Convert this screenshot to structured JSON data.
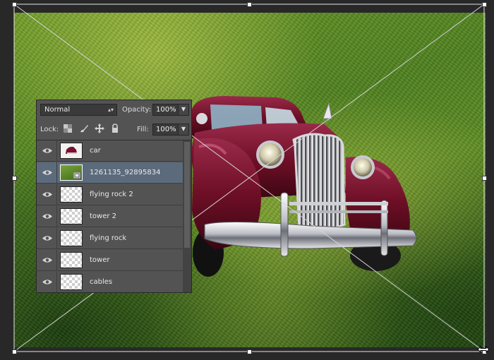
{
  "canvas": {
    "image_subject": "vintage maroon car on grass texture"
  },
  "layers_panel": {
    "blend_mode": "Normal",
    "opacity_label": "Opacity:",
    "opacity_value": "100%",
    "lock_label": "Lock:",
    "fill_label": "Fill:",
    "fill_value": "100%",
    "lock_icons": [
      "lock-transparent-pixels-icon",
      "lock-image-pixels-icon",
      "lock-position-icon",
      "lock-all-icon"
    ],
    "layers": [
      {
        "name": "car",
        "thumb": "car-thumb",
        "active": false
      },
      {
        "name": "1261135_92895834",
        "thumb": "grass-thumb",
        "active": true
      },
      {
        "name": "flying rock 2",
        "thumb": "transparent",
        "active": false
      },
      {
        "name": "tower 2",
        "thumb": "transparent",
        "active": false
      },
      {
        "name": "flying rock",
        "thumb": "transparent",
        "active": false
      },
      {
        "name": "tower",
        "thumb": "transparent",
        "active": false
      },
      {
        "name": "cables",
        "thumb": "transparent",
        "active": false
      }
    ]
  },
  "colors": {
    "panel_bg": "#535353",
    "active_layer": "#5c6b7c",
    "car_body": "#6e0f26"
  }
}
